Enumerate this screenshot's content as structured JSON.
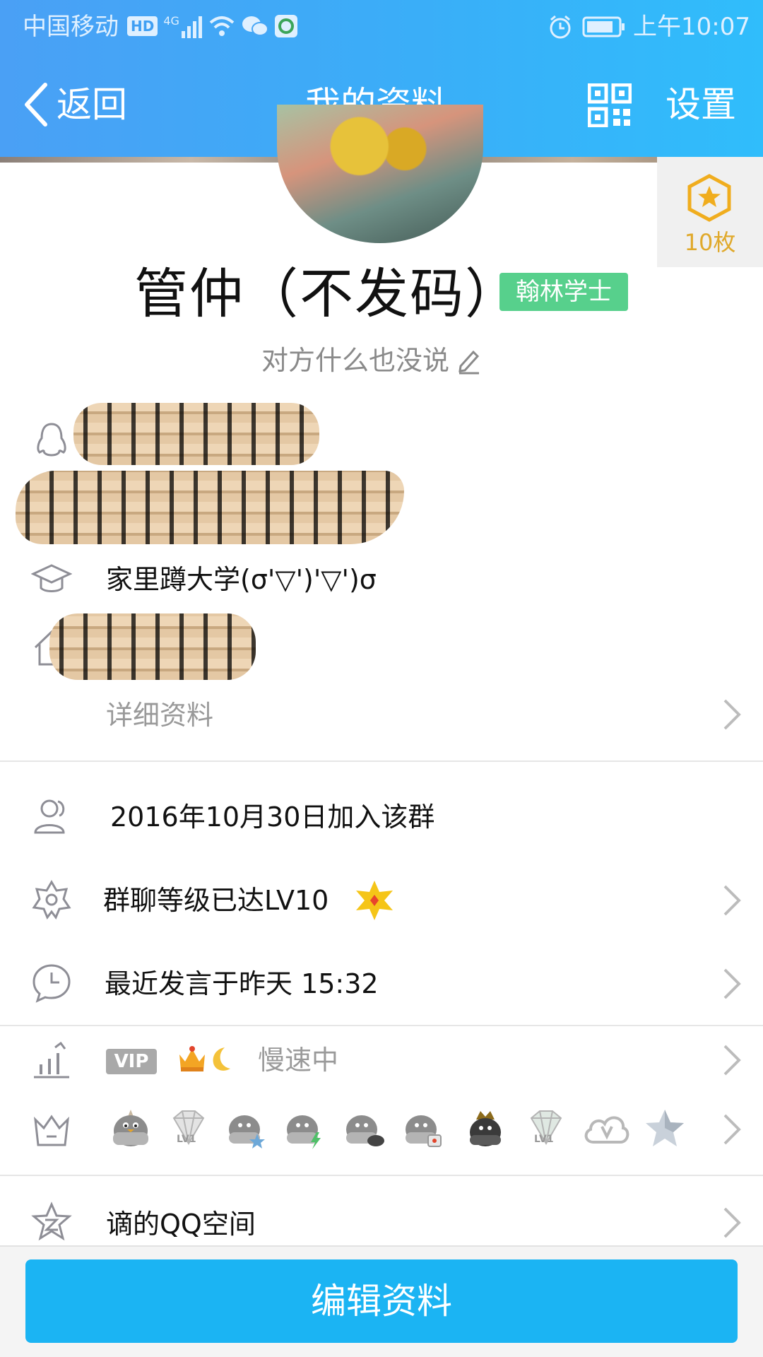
{
  "status_bar": {
    "carrier": "中国移动",
    "hd": "HD",
    "network": "4G",
    "time": "上午10:07"
  },
  "nav": {
    "back_label": "返回",
    "title": "我的资料",
    "settings_label": "设置"
  },
  "profile": {
    "medal_count": "10枚",
    "name": "管仲（不发码）",
    "badge": "翰林学士",
    "signature": "对方什么也没说"
  },
  "info": {
    "school": "家里蹲大学(σ'▽')'▽')σ",
    "detail_label": "详细资料"
  },
  "group": {
    "joined": "2016年10月30日加入该群",
    "level": "群聊等级已达LV10",
    "last_spoke": "最近发言于昨天 15:32"
  },
  "vip": {
    "tag": "VIP",
    "speed": "慢速中"
  },
  "badges": {
    "lv1_a": "LV1",
    "lv1_b": "LV1"
  },
  "qzone": {
    "label": "谪的QQ空间"
  },
  "actions": {
    "edit_label": "编辑资料"
  },
  "colors": {
    "header_start": "#4aa0f5",
    "header_end": "#30bdfb",
    "badge_green": "#57d08c",
    "medal_gold": "#e0a92b",
    "button_blue": "#1bb4f3"
  }
}
